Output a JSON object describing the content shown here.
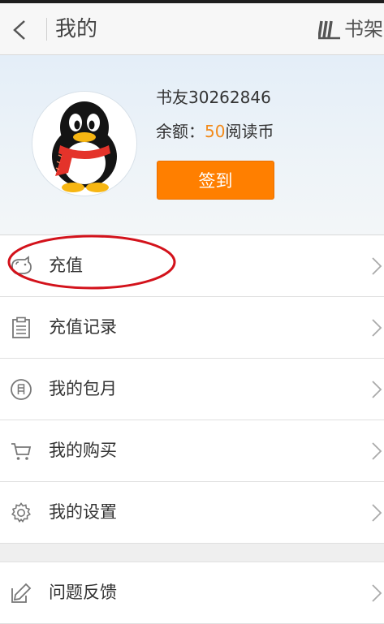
{
  "header": {
    "title": "我的",
    "shelf_label": "书架"
  },
  "profile": {
    "username": "书友30262846",
    "balance_prefix": "余额：",
    "balance_amount": "50",
    "balance_unit": "阅读币",
    "signin_label": "签到"
  },
  "menu": {
    "items": [
      {
        "label": "充值",
        "icon": "piggy-bank-icon"
      },
      {
        "label": "充值记录",
        "icon": "clipboard-icon"
      },
      {
        "label": "我的包月",
        "icon": "monthly-calendar-icon"
      },
      {
        "label": "我的购买",
        "icon": "shopping-cart-icon"
      },
      {
        "label": "我的设置",
        "icon": "gear-icon"
      },
      {
        "label": "问题反馈",
        "icon": "edit-icon"
      }
    ]
  },
  "colors": {
    "accent": "#ff7f00",
    "coins": "#f28a1a",
    "annotation": "#d3121b"
  }
}
